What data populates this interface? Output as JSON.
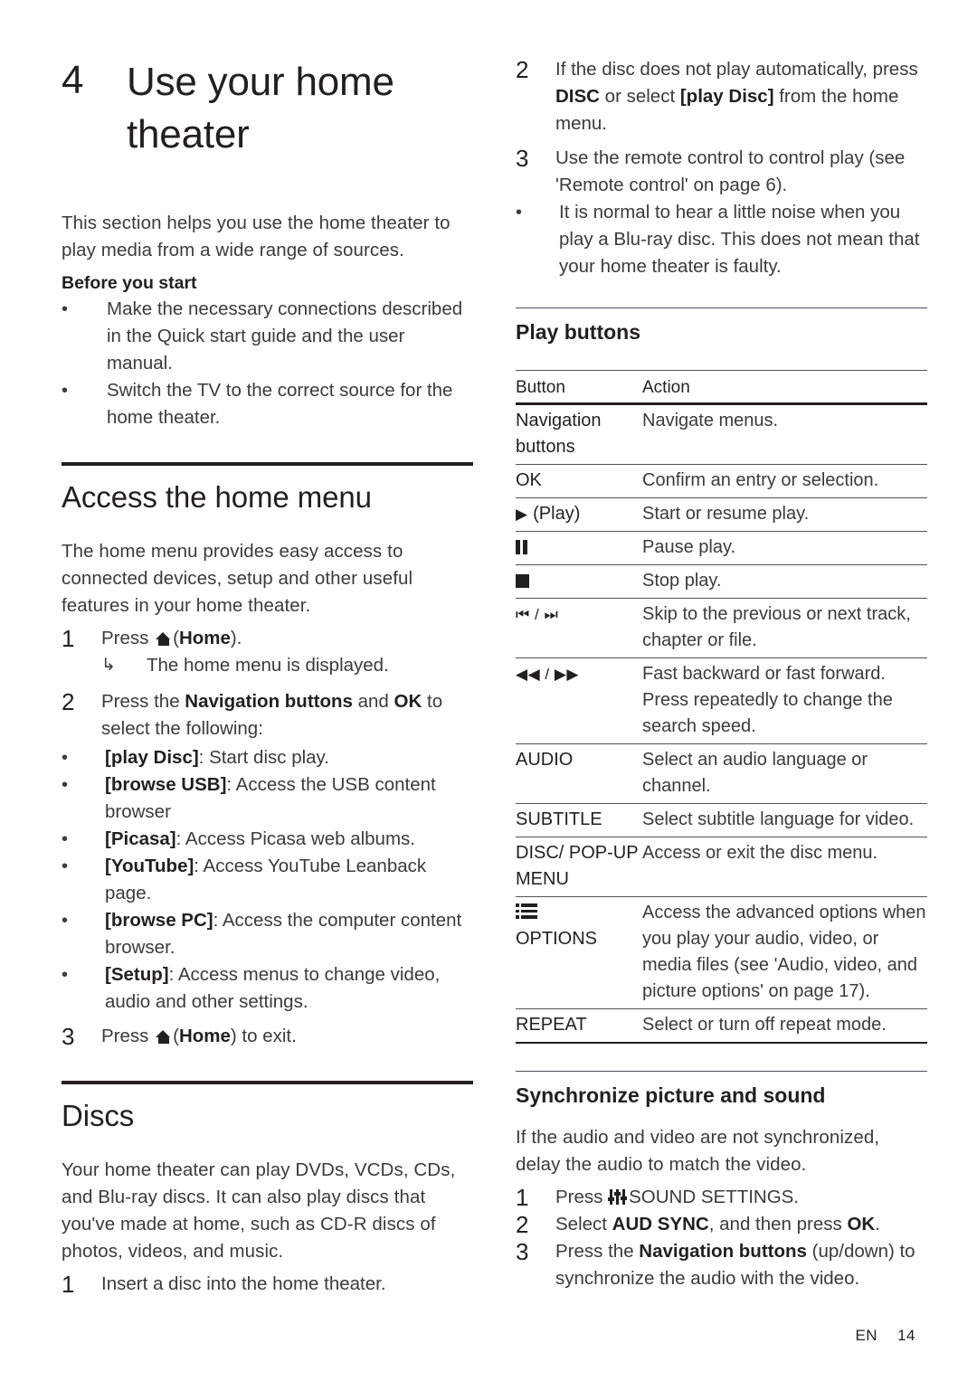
{
  "chapter": {
    "number": "4",
    "title": "Use your home theater"
  },
  "intro": {
    "paragraph": "This section helps you use the home theater to play media from a wide range of sources.",
    "before_heading": "Before you start",
    "before_items": [
      "Make the necessary connections described in the Quick start guide and the user manual.",
      "Switch the TV to the correct source for the home theater."
    ]
  },
  "home_menu": {
    "heading": "Access the home menu",
    "paragraph": "The home menu provides easy access to connected devices, setup and other useful features in your home theater.",
    "step1": {
      "num": "1",
      "pre": "Press ",
      "bold": "Home",
      "post": ").",
      "paren_open": "(",
      "result_arrow": "↳",
      "result": "The home menu is displayed."
    },
    "step2": {
      "num": "2",
      "pre": "Press the ",
      "bold1": "Navigation buttons",
      "mid": " and ",
      "bold2": "OK",
      "post": " to select the following:",
      "options": [
        {
          "label": "[play Disc]",
          "desc": ": Start disc play."
        },
        {
          "label": "[browse USB]",
          "desc": ": Access the USB content browser"
        },
        {
          "label": "[Picasa]",
          "desc": ": Access Picasa web albums."
        },
        {
          "label": "[YouTube]",
          "desc": ": Access YouTube Leanback page."
        },
        {
          "label": "[browse PC]",
          "desc": ": Access the computer content browser."
        },
        {
          "label": "[Setup]",
          "desc": ": Access menus to change video, audio and other settings."
        }
      ]
    },
    "step3": {
      "num": "3",
      "pre": "Press ",
      "bold": "Home",
      "post": ") to exit."
    }
  },
  "discs": {
    "heading": "Discs",
    "paragraph": "Your home theater can play DVDs, VCDs, CDs, and Blu-ray discs. It can also play discs that you've made at home, such as CD-R discs of photos, videos, and music.",
    "step1": {
      "num": "1",
      "text": "Insert a disc into the home theater."
    },
    "step2": {
      "num": "2",
      "pre": "If the disc does not play automatically, press ",
      "bold1": "DISC",
      "mid": " or select ",
      "bold2": "[play Disc]",
      "post": " from the home menu."
    },
    "step3": {
      "num": "3",
      "text": "Use the remote control to control play (see 'Remote control' on page 6).",
      "note": "It is normal to hear a little noise when you play a Blu-ray disc. This does not mean that your home theater is faulty."
    }
  },
  "play_buttons": {
    "heading": "Play buttons",
    "table": {
      "headers": [
        "Button",
        "Action"
      ],
      "rows": [
        {
          "button": "Navigation buttons",
          "icon": "",
          "action": "Navigate menus."
        },
        {
          "button": "OK",
          "icon": "",
          "action": "Confirm an entry or selection."
        },
        {
          "button": "(Play)",
          "icon": "play-icon",
          "action": "Start or resume play."
        },
        {
          "button": "",
          "icon": "pause-icon",
          "action": "Pause play."
        },
        {
          "button": "",
          "icon": "stop-icon",
          "action": "Stop play."
        },
        {
          "button": "",
          "icon": "previous-next-icon",
          "action": "Skip to the previous or next track, chapter or file."
        },
        {
          "button": "",
          "icon": "rewind-forward-icon",
          "action": "Fast backward or fast forward. Press repeatedly to change the search speed."
        },
        {
          "button": "AUDIO",
          "icon": "",
          "action": "Select an audio language or channel."
        },
        {
          "button": "SUBTITLE",
          "icon": "",
          "action": "Select subtitle language for video."
        },
        {
          "button": "DISC/ POP-UP MENU",
          "icon": "",
          "action": "Access or exit the disc menu."
        },
        {
          "button": "OPTIONS",
          "icon": "options-icon",
          "action": "Access the advanced options when you play your audio, video, or media files (see 'Audio, video, and picture options' on page 17)."
        },
        {
          "button": "REPEAT",
          "icon": "",
          "action": "Select or turn off repeat mode."
        }
      ],
      "glyphs": {
        "play": "▶",
        "previous_next": "⏮ / ⏭",
        "rewind_forward": "◀◀ / ▶▶"
      }
    }
  },
  "sync": {
    "heading": "Synchronize picture and sound",
    "paragraph": "If the audio and video are not synchronized, delay the audio to match the video.",
    "step1": {
      "num": "1",
      "pre": "Press ",
      "post": "SOUND SETTINGS."
    },
    "step2": {
      "num": "2",
      "pre": "Select ",
      "bold1": "AUD SYNC",
      "mid": ", and then press ",
      "bold2": "OK",
      "post": "."
    },
    "step3": {
      "num": "3",
      "pre": "Press the ",
      "bold1": "Navigation buttons",
      "post": " (up/down) to synchronize the audio with the video."
    }
  },
  "footer": {
    "language": "EN",
    "page": "14"
  }
}
